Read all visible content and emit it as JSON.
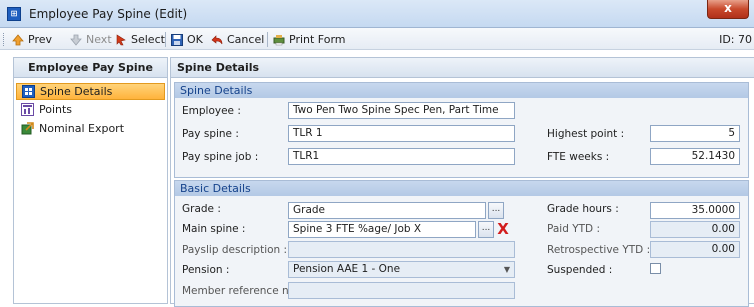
{
  "window": {
    "title": "Employee Pay Spine (Edit)",
    "icon_name": "app-grid-icon",
    "close_label": "x"
  },
  "toolbar": {
    "prev": "Prev",
    "next": "Next",
    "select": "Select",
    "ok": "OK",
    "cancel": "Cancel",
    "print_form": "Print Form",
    "record_id": "ID: 70"
  },
  "sidebar": {
    "header": "Employee Pay Spine",
    "items": [
      {
        "label": "Spine Details",
        "active": true,
        "icon": "grid-icon"
      },
      {
        "label": "Points",
        "active": false,
        "icon": "chart-icon"
      },
      {
        "label": "Nominal Export",
        "active": false,
        "icon": "export-icon"
      }
    ]
  },
  "main": {
    "header": "Spine Details",
    "spine_details": {
      "title": "Spine Details",
      "employee_label": "Employee :",
      "employee_value": "Two Pen Two Spine Spec Pen, Part Time",
      "pay_spine_label": "Pay spine :",
      "pay_spine_value": "TLR 1",
      "pay_spine_job_label": "Pay spine job :",
      "pay_spine_job_value": "TLR1",
      "highest_point_label": "Highest point :",
      "highest_point_value": "5",
      "fte_weeks_label": "FTE weeks :",
      "fte_weeks_value": "52.1430"
    },
    "basic_details": {
      "title": "Basic Details",
      "grade_label": "Grade :",
      "grade_value": "Grade",
      "main_spine_label": "Main spine :",
      "main_spine_value": "Spine 3 FTE %age/ Job X",
      "payslip_desc_label": "Payslip description :",
      "payslip_desc_value": "",
      "pension_label": "Pension :",
      "pension_value": "Pension AAE 1 - One",
      "member_ref_label": "Member reference no :",
      "member_ref_value": "",
      "grade_hours_label": "Grade hours :",
      "grade_hours_value": "35.0000",
      "paid_ytd_label": "Paid YTD :",
      "paid_ytd_value": "0.00",
      "retro_ytd_label": "Retrospective YTD :",
      "retro_ytd_value": "0.00",
      "suspended_label": "Suspended :",
      "browse_label": "...",
      "delete_label": "X"
    }
  },
  "colors": {
    "accent": "#ffb33c",
    "group_header": "#b3c9e5",
    "header_text": "#15428b"
  }
}
